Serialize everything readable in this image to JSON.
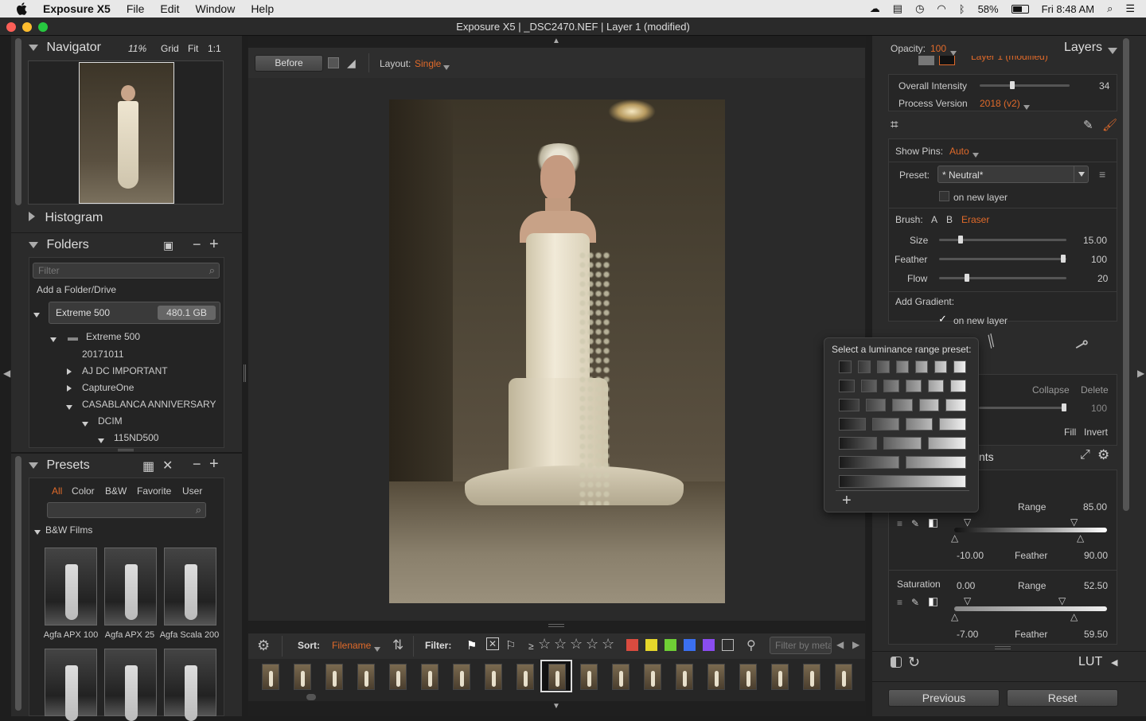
{
  "menubar": {
    "app_name": "Exposure X5",
    "items": [
      "File",
      "Edit",
      "Window",
      "Help"
    ],
    "battery": "58%",
    "clock": "Fri 8:48 AM"
  },
  "window": {
    "title": "Exposure X5 | _DSC2470.NEF | Layer 1 (modified)"
  },
  "navigator": {
    "title": "Navigator",
    "zoom": "11%",
    "grid": "Grid",
    "fit": "Fit",
    "one_to_one": "1:1"
  },
  "histogram": {
    "title": "Histogram"
  },
  "folders": {
    "title": "Folders",
    "filter_placeholder": "Filter",
    "add_folder": "Add a Folder/Drive",
    "drive_name": "Extreme 500",
    "drive_size": "480.1 GB",
    "tree": [
      "Extreme 500",
      "20171011",
      "AJ DC IMPORTANT",
      "CaptureOne",
      "CASABLANCA ANNIVERSARY",
      "DCIM",
      "115ND500"
    ]
  },
  "presets": {
    "title": "Presets",
    "tabs": [
      "All",
      "Color",
      "B&W",
      "Favorite",
      "User"
    ],
    "group": "B&W Films",
    "items": [
      "Agfa APX 100",
      "Agfa APX 25",
      "Agfa Scala 200"
    ]
  },
  "toolbar": {
    "before_label": "Before",
    "layout_label": "Layout:",
    "layout_value": "Single"
  },
  "filmbar": {
    "sort_label": "Sort:",
    "sort_value": "Filename",
    "filter_label": "Filter:",
    "gte": "≥",
    "meta_placeholder": "Filter by metadata"
  },
  "right": {
    "opacity_label": "Opacity:",
    "opacity_value": "100",
    "layers_title": "Layers",
    "layer_name": "Layer 1 (modified)",
    "overall_intensity_label": "Overall Intensity",
    "overall_intensity_value": "34",
    "process_version_label": "Process Version",
    "process_version_value": "2018 (v2)",
    "show_pins_label": "Show Pins:",
    "show_pins_value": "Auto",
    "preset_label": "Preset:",
    "preset_value": "* Neutral*",
    "on_new_layer": "on new layer",
    "brush_label": "Brush:",
    "brush_a": "A",
    "brush_b": "B",
    "brush_eraser": "Eraser",
    "size_label": "Size",
    "size_value": "15.00",
    "feather_label": "Feather",
    "feather_value": "100",
    "flow_label": "Flow",
    "flow_value": "20",
    "add_gradient_label": "Add Gradient:",
    "gradient_new_layer": "on new layer",
    "collapse": "Collapse",
    "delete": "Delete",
    "partial_value": "100",
    "fill": "Fill",
    "invert": "Invert",
    "adjustments_partial": "nts",
    "range_label": "Range",
    "range_value": "85.00",
    "lum_low": "-10.00",
    "feather2_label": "Feather",
    "feather2_value": "90.00",
    "saturation_label": "Saturation",
    "saturation_value": "0.00",
    "range2_label": "Range",
    "range2_value": "52.50",
    "sat_low": "-7.00",
    "feather3_label": "Feather",
    "feather3_value": "59.50",
    "lut_label": "LUT",
    "previous": "Previous",
    "reset": "Reset"
  },
  "popup": {
    "title": "Select a luminance range preset:",
    "add": "+"
  }
}
